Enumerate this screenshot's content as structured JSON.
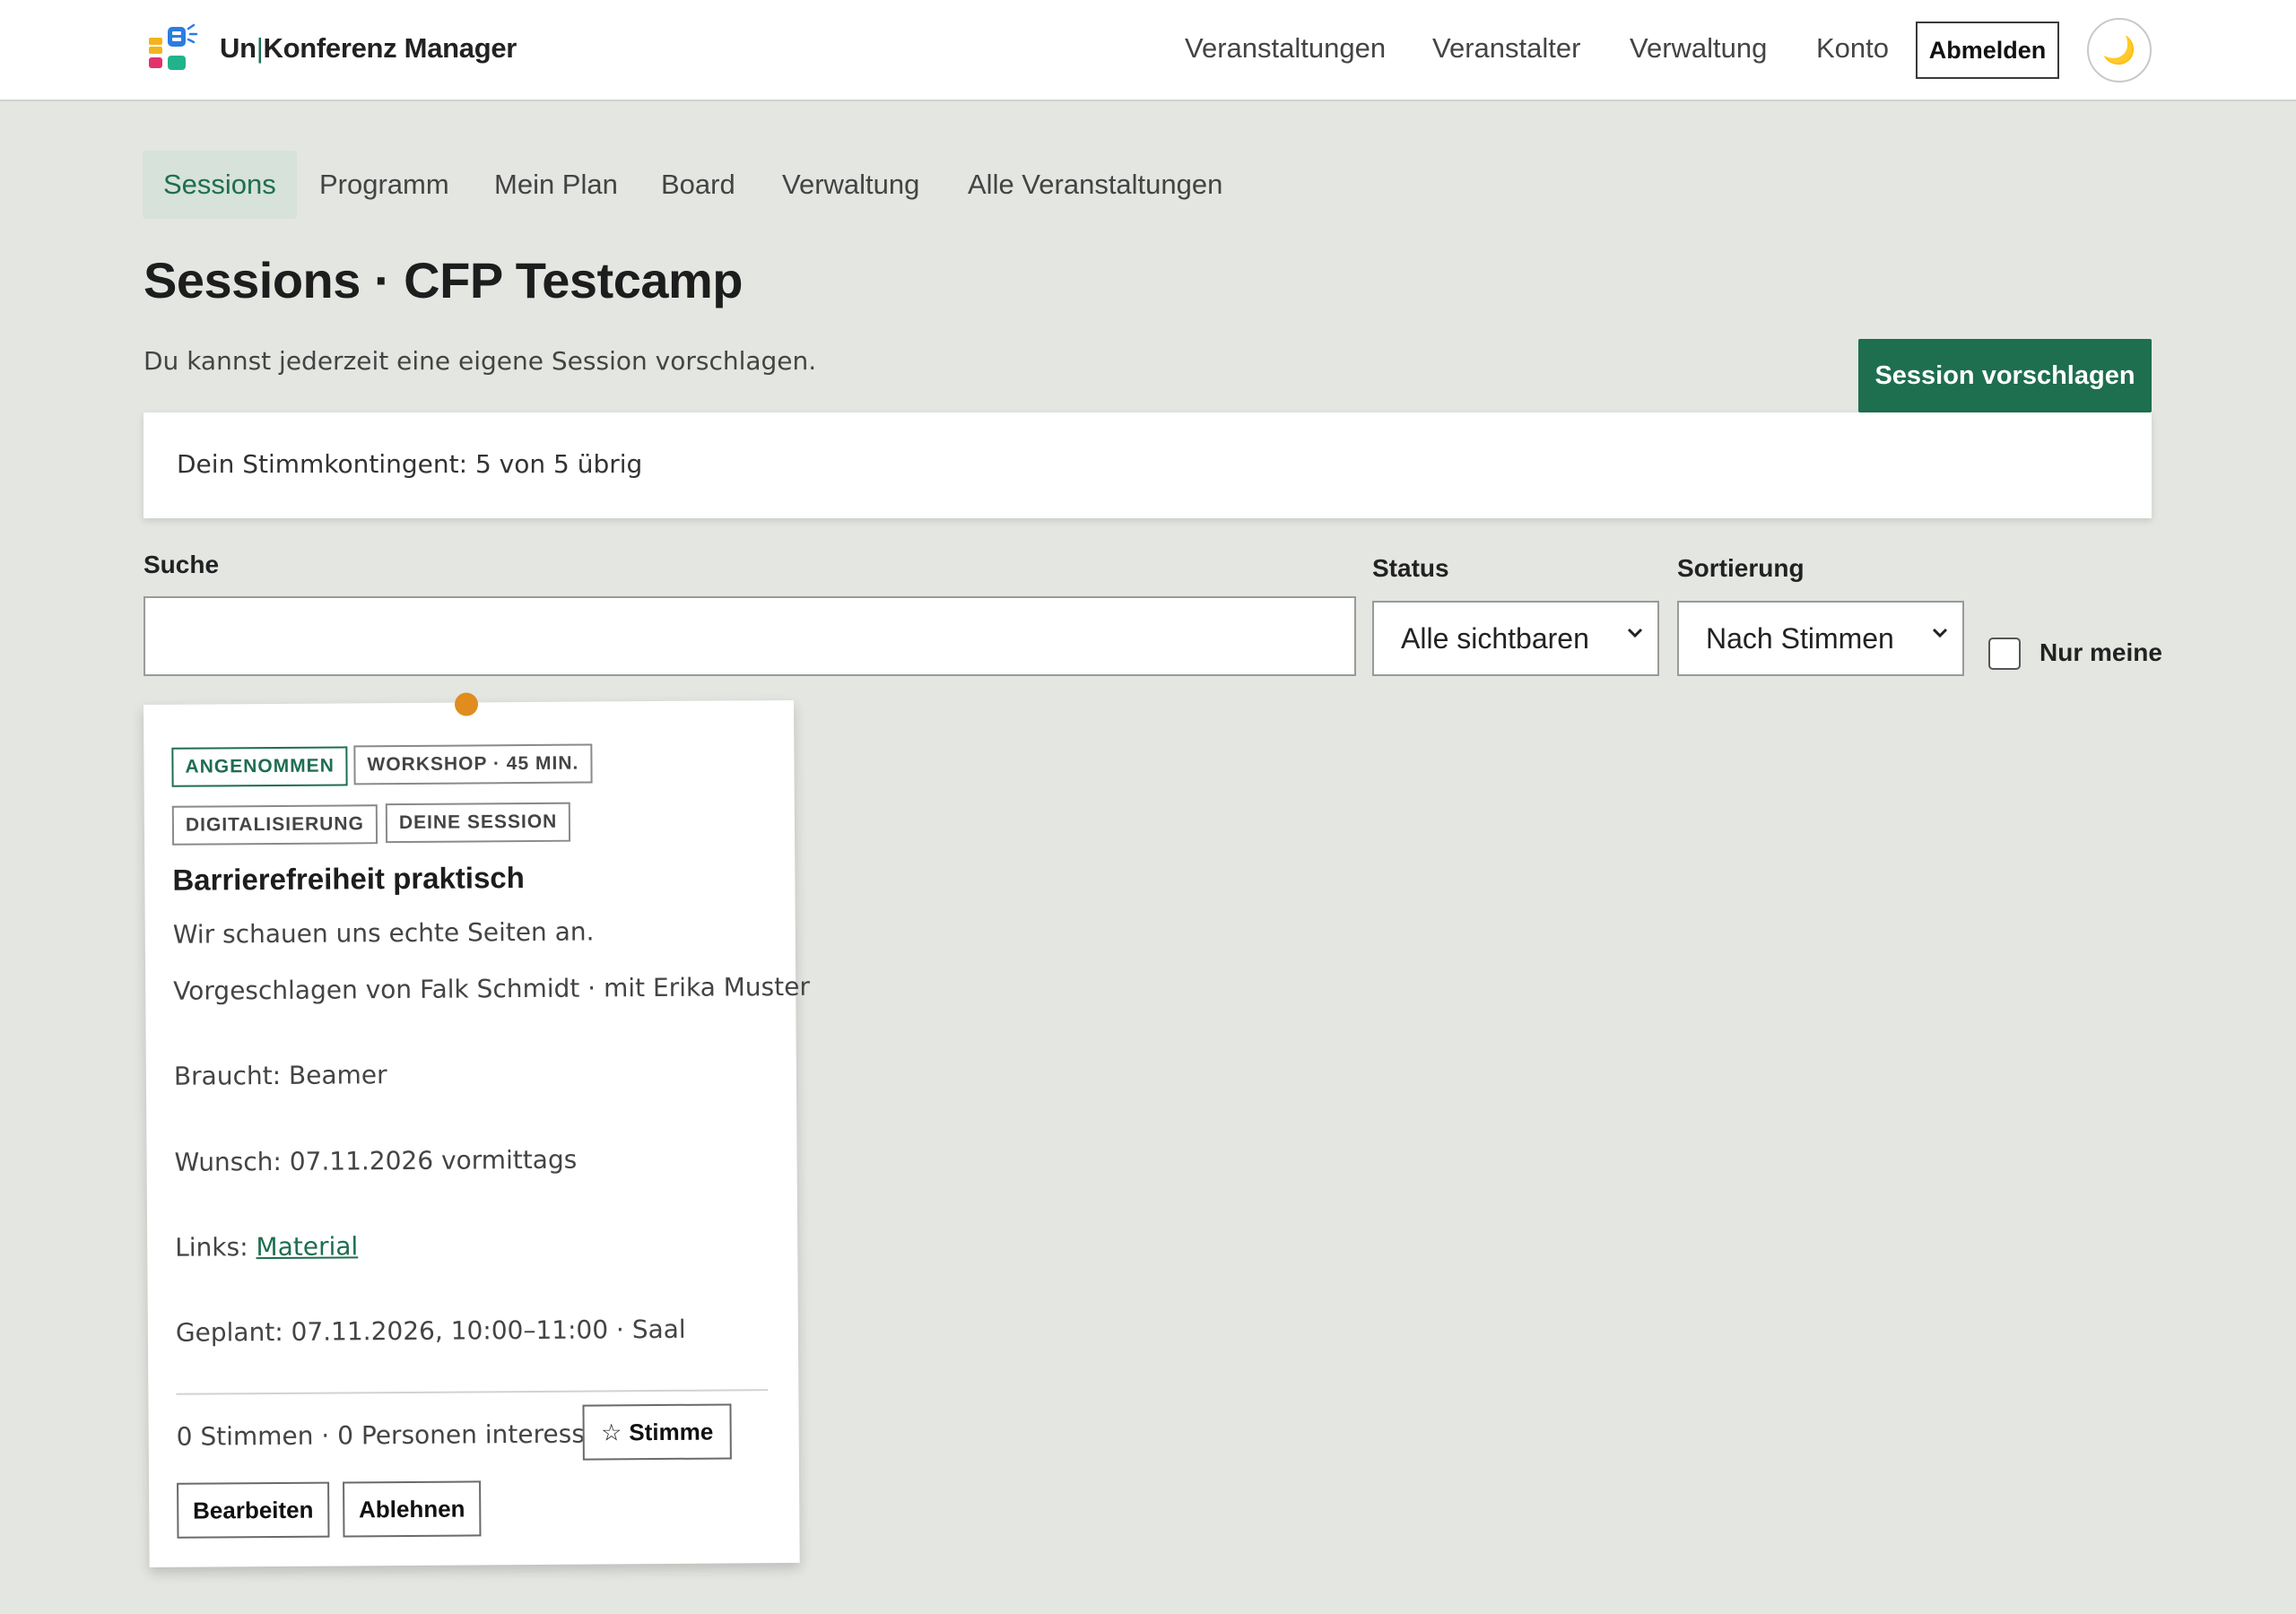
{
  "header": {
    "brand_prefix": "Un",
    "brand_sep": "|",
    "brand_name": "Konferenz Manager",
    "nav": [
      "Veranstaltungen",
      "Veranstalter",
      "Verwaltung",
      "Konto"
    ],
    "logout_label": "Abmelden",
    "theme_icon": "🌙"
  },
  "subnav": {
    "tabs": [
      "Sessions",
      "Programm",
      "Mein Plan",
      "Board",
      "Verwaltung",
      "Alle Veranstaltungen"
    ],
    "active": "Sessions"
  },
  "page": {
    "title": "Sessions · CFP Testcamp",
    "intro": "Du kannst jederzeit eine eigene Session vorschlagen.",
    "propose_label": "Session vorschlagen",
    "quota_text": "Dein Stimmkontingent: 5 von 5 übrig"
  },
  "filters": {
    "search_label": "Suche",
    "search_value": "",
    "status_label": "Status",
    "status_value": "Alle sichtbaren",
    "sort_label": "Sortierung",
    "sort_value": "Nach Stimmen",
    "mine_label": "Nur meine",
    "mine_checked": false
  },
  "session": {
    "tags": [
      "ANGENOMMEN",
      "WORKSHOP · 45 MIN.",
      "DIGITALISIERUNG",
      "DEINE SESSION"
    ],
    "title": "Barrierefreiheit praktisch",
    "description": "Wir schauen uns echte Seiten an.",
    "proposed_by": "Vorgeschlagen von Falk Schmidt · mit Erika Muster",
    "needs": "Braucht: Beamer",
    "wish": "Wunsch: 07.11.2026 vormittags",
    "links_prefix": "Links: ",
    "link_label": "Material",
    "planned": "Geplant: 07.11.2026, 10:00–11:00 · Saal",
    "stats": "0 Stimmen · 0 Personen interessiert",
    "vote_label": "Stimme",
    "edit_label": "Bearbeiten",
    "reject_label": "Ablehnen"
  },
  "colors": {
    "accent": "#1e6e50",
    "background": "#e4e6e2",
    "pin": "#e08c1f"
  }
}
